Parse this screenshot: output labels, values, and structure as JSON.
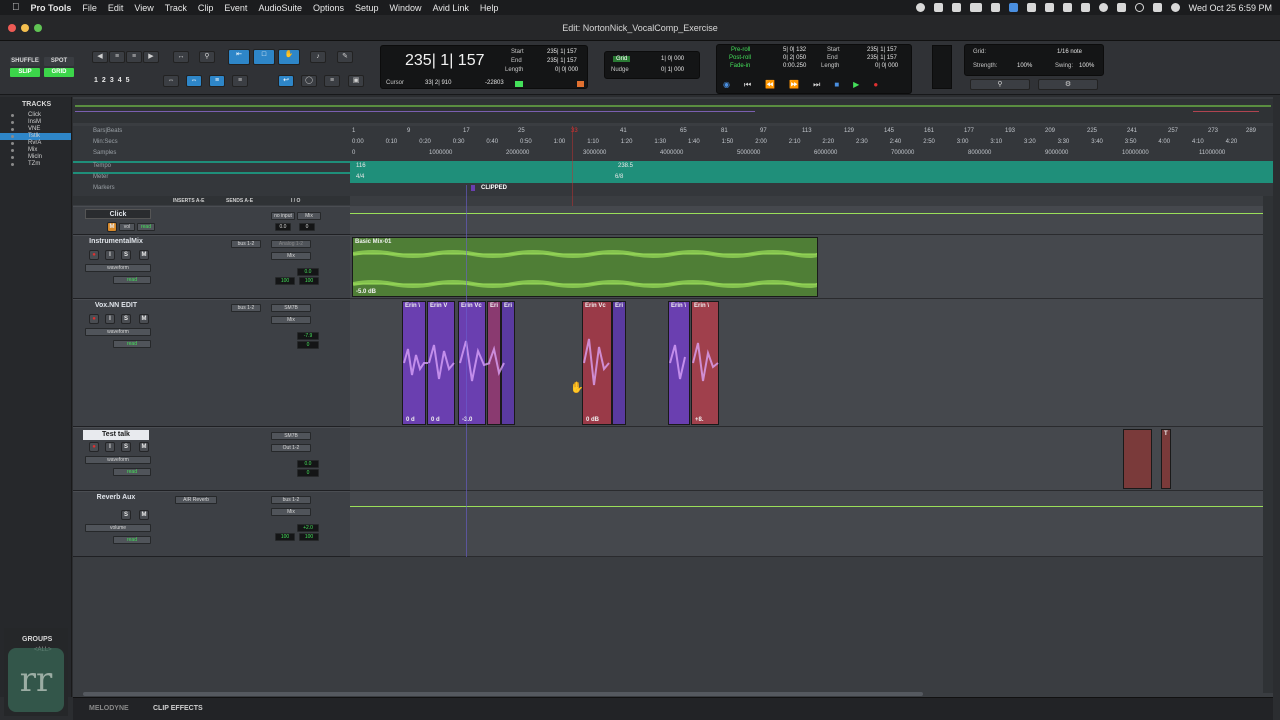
{
  "menubar": {
    "app": "Pro Tools",
    "items": [
      "File",
      "Edit",
      "View",
      "Track",
      "Clip",
      "Event",
      "AudioSuite",
      "Options",
      "Setup",
      "Window",
      "Avid Link",
      "Help"
    ],
    "clock": "Wed Oct 25  6:59 PM"
  },
  "window": {
    "title": "Edit: NortonNick_VocalComp_Exercise"
  },
  "toolbar": {
    "modes": [
      "SHUFFLE",
      "SPOT",
      "SLIP",
      "GRID"
    ],
    "zoom_presets": [
      "1",
      "2",
      "3",
      "4",
      "5"
    ],
    "main_counter": "235| 1| 157",
    "sel_labels": [
      "Start",
      "End",
      "Length"
    ],
    "sel_values": [
      "235| 1| 157",
      "235| 1| 157",
      "0| 0| 000"
    ],
    "cursor_label": "Cursor",
    "cursor_value": "33| 2| 910",
    "cursor_samples": "-22803",
    "grid_label": "Grid",
    "grid_value": "1| 0| 000",
    "nudge_label": "Nudge",
    "nudge_value": "0| 1| 000",
    "pre_labels": [
      "Pre-roll",
      "Post-roll",
      "Fade-in"
    ],
    "pre_values": [
      "5| 0| 132",
      "0| 2| 050",
      "0:00.250"
    ],
    "pb_labels": [
      "Start",
      "End",
      "Length"
    ],
    "pb_values": [
      "235| 1| 157",
      "235| 1| 157",
      "0| 0| 000"
    ],
    "grid2_label": "Grid:",
    "grid2_value": "1/16 note",
    "strength_label": "Strength:",
    "strength_value": "100%",
    "swing_label": "Swing:",
    "swing_value": "100%"
  },
  "tracklist": {
    "title": "TRACKS",
    "items": [
      "Click",
      "InsM",
      "VNE",
      "Tstlk",
      "RvrA",
      "Mix",
      "Micln",
      "TZm"
    ]
  },
  "rulers": {
    "labels": [
      "Bars|Beats",
      "Min:Secs",
      "Samples",
      "Tempo",
      "Meter",
      "Markers"
    ],
    "bars": [
      "1",
      "9",
      "17",
      "25",
      "33",
      "41",
      "65",
      "81",
      "97",
      "113",
      "129",
      "145",
      "161",
      "177",
      "193",
      "209",
      "225",
      "241",
      "257",
      "273",
      "289"
    ],
    "minsecs": [
      "0:00",
      "0:10",
      "0:20",
      "0:30",
      "0:40",
      "0:50",
      "1:00",
      "1:10",
      "1:20",
      "1:30",
      "1:40",
      "1:50",
      "2:00",
      "2:10",
      "2:20",
      "2:30",
      "2:40",
      "2:50",
      "3:00",
      "3:10",
      "3:20",
      "3:30",
      "3:40",
      "3:50",
      "4:00",
      "4:10",
      "4:20"
    ],
    "samples": [
      "0",
      "1000000",
      "2000000",
      "3000000",
      "4000000",
      "5000000",
      "6000000",
      "7000000",
      "8000000",
      "9000000",
      "10000000",
      "11000000"
    ],
    "tempo1": "116",
    "tempo2": "238.5",
    "meter1": "4/4",
    "meter2": "6/8",
    "marker": "CLIPPED"
  },
  "header": {
    "inserts": "INSERTS A-E",
    "sends": "SENDS A-E",
    "io": "I / O",
    "slots": [
      "a",
      "b",
      "c",
      "d",
      "e"
    ]
  },
  "tracks": [
    {
      "name": "Click",
      "io1": "no input",
      "io2": "Mix",
      "vol": "0.0",
      "pan": "0",
      "mode": "vol",
      "auto": "read"
    },
    {
      "name": "InstrumentalMix",
      "send": "bus 1-2",
      "io1": "Analog 1-2",
      "io2": "Mix",
      "view": "waveform",
      "auto": "read",
      "vol": "0.0",
      "pan1": "100",
      "pan2": "100",
      "clip": "Basic Mix-01",
      "gain": "-5.0 dB"
    },
    {
      "name": "Vox.NN EDIT",
      "send": "bus 1-2",
      "io1": "SM7B",
      "io2": "Mix",
      "view": "waveform",
      "auto": "read",
      "vol": "-7.9",
      "pan": "0"
    },
    {
      "name": "Test talk",
      "io1": "SM7B",
      "io2": "Out 1-2",
      "view": "waveform",
      "auto": "read",
      "vol": "0.0",
      "pan": "0"
    },
    {
      "name": "Reverb Aux",
      "insert": "AIR Reverb",
      "send": "bus 1-2",
      "io2": "Mix",
      "view": "volume",
      "auto": "read",
      "vol": "+2.0",
      "pan1": "100",
      "pan2": "100"
    }
  ],
  "vox_clips": [
    {
      "label": "Erin \\",
      "gain": "0 d"
    },
    {
      "label": "Erin V",
      "gain": "0 d"
    },
    {
      "label": "Erin Vc",
      "gain": "-3.0"
    },
    {
      "label": "Eri",
      "gain": ""
    },
    {
      "label": "Eri",
      "gain": ""
    },
    {
      "label": "Erin Vc",
      "gain": "0 dB"
    },
    {
      "label": "Eri",
      "gain": ""
    },
    {
      "label": "Erin \\",
      "gain": ""
    },
    {
      "label": "Erin \\",
      "gain": "+8."
    }
  ],
  "test_clip_label": "T",
  "groups": {
    "title": "GROUPS",
    "all": "<ALL>"
  },
  "bottom": {
    "tabs": [
      "MELODYNE",
      "CLIP EFFECTS"
    ]
  },
  "colors": {
    "clip_green": "#5e9b3a",
    "vox_purple": "#6a3fb0",
    "vox_red": "#b04450",
    "tempo_teal": "#1f8f7a",
    "selection_blue": "#2e86c8"
  }
}
